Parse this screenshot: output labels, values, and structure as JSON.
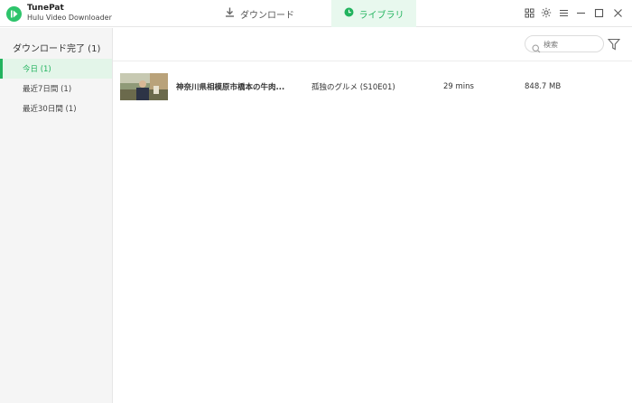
{
  "app": {
    "name": "TunePat",
    "subtitle": "Hulu Video Downloader"
  },
  "tabs": {
    "download": "ダウンロード",
    "library": "ライブラリ"
  },
  "sidebar": {
    "heading": "ダウンロード完了 (1)",
    "items": [
      {
        "label": "今日 (1)",
        "active": true
      },
      {
        "label": "最近7日間 (1)",
        "active": false
      },
      {
        "label": "最近30日間 (1)",
        "active": false
      }
    ]
  },
  "search": {
    "placeholder": "検索"
  },
  "rows": [
    {
      "title": "神奈川県相模原市橋本の牛肉...",
      "series": "孤独のグルメ (S10E01)",
      "duration": "29 mins",
      "size": "848.7 MB"
    }
  ],
  "colors": {
    "accent": "#22b35e",
    "accent_bg": "#e8f8ee",
    "sidebar_bg": "#f5f5f5"
  },
  "icons": {
    "logo": "play-circle-icon",
    "download_tab": "download-icon",
    "library_tab": "clock-icon",
    "window": [
      "grid-icon",
      "gear-icon",
      "menu-icon",
      "minimize-icon",
      "maximize-icon",
      "close-icon"
    ],
    "search": "search-icon",
    "filter": "filter-icon"
  }
}
